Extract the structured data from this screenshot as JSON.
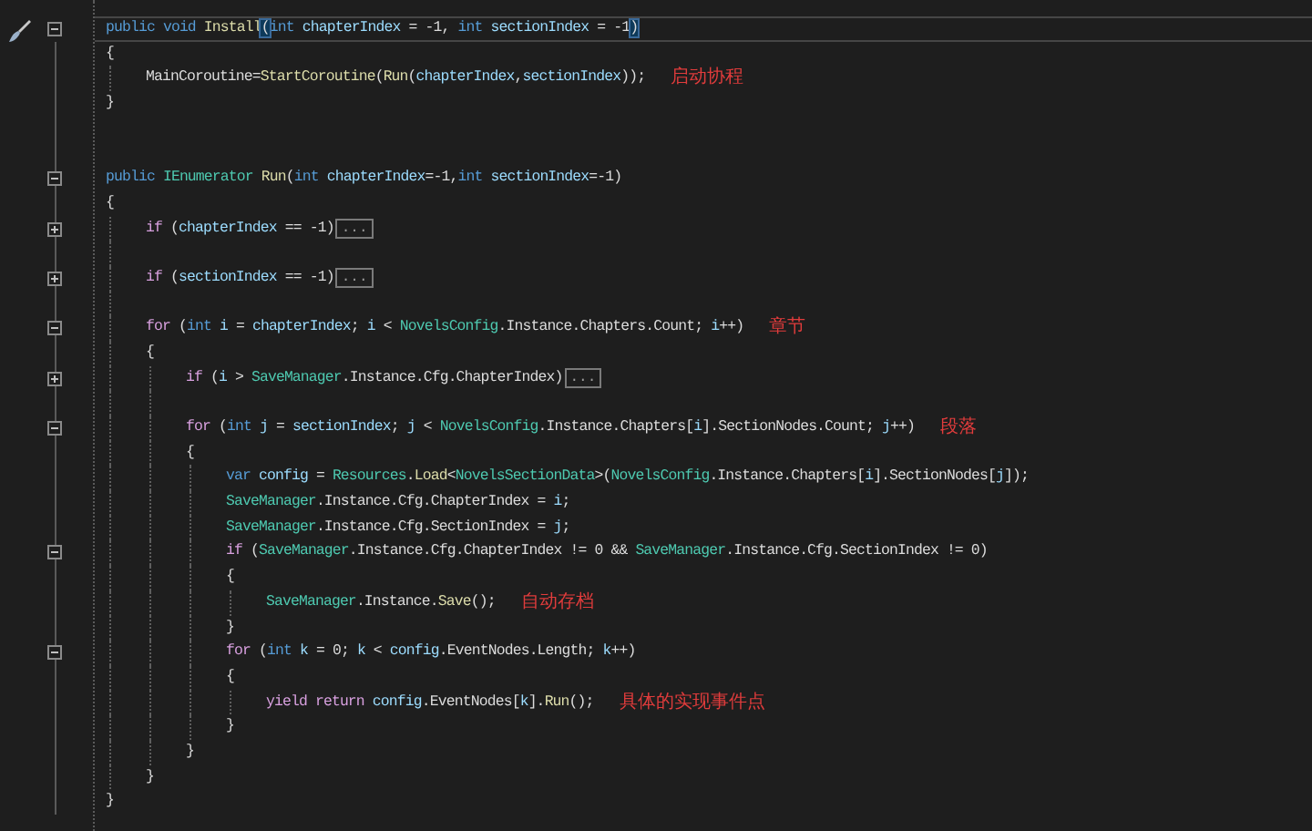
{
  "editor": {
    "lines": [
      {
        "kind": "code",
        "current": true,
        "folded": false,
        "tokens": [
          {
            "kind": "kw",
            "text": "public void "
          },
          {
            "kind": "fn",
            "text": "Install"
          },
          {
            "kind": "match",
            "text": "("
          },
          {
            "kind": "kw",
            "text": "int "
          },
          {
            "kind": "var",
            "text": "chapterIndex"
          },
          {
            "kind": "txt",
            "text": " = -1, "
          },
          {
            "kind": "kw",
            "text": "int "
          },
          {
            "kind": "var",
            "text": "sectionIndex"
          },
          {
            "kind": "txt",
            "text": " = -1"
          },
          {
            "kind": "match",
            "text": ")"
          }
        ]
      },
      {
        "kind": "code",
        "current": false,
        "tokens": [
          {
            "kind": "txt",
            "text": "{"
          }
        ],
        "children": [
          {
            "kind": "code",
            "current": false,
            "note": "启动协程",
            "tokens": [
              {
                "kind": "txt",
                "text": "MainCoroutine="
              },
              {
                "kind": "fn",
                "text": "StartCoroutine"
              },
              {
                "kind": "txt",
                "text": "("
              },
              {
                "kind": "fn",
                "text": "Run"
              },
              {
                "kind": "txt",
                "text": "("
              },
              {
                "kind": "var",
                "text": "chapterIndex"
              },
              {
                "kind": "txt",
                "text": ","
              },
              {
                "kind": "var",
                "text": "sectionIndex"
              },
              {
                "kind": "txt",
                "text": "));"
              }
            ]
          }
        ]
      },
      {
        "kind": "code",
        "current": false,
        "tokens": [
          {
            "kind": "txt",
            "text": "}"
          }
        ]
      },
      {
        "kind": "blank",
        "current": false
      },
      {
        "kind": "blank",
        "current": false
      },
      {
        "kind": "code",
        "current": false,
        "folded": false,
        "tokens": [
          {
            "kind": "kw",
            "text": "public "
          },
          {
            "kind": "type",
            "text": "IEnumerator "
          },
          {
            "kind": "fn",
            "text": "Run"
          },
          {
            "kind": "txt",
            "text": "("
          },
          {
            "kind": "kw",
            "text": "int "
          },
          {
            "kind": "var",
            "text": "chapterIndex"
          },
          {
            "kind": "txt",
            "text": "=-1,"
          },
          {
            "kind": "kw",
            "text": "int "
          },
          {
            "kind": "var",
            "text": "sectionIndex"
          },
          {
            "kind": "txt",
            "text": "=-1)"
          }
        ]
      },
      {
        "kind": "code",
        "current": false,
        "tokens": [
          {
            "kind": "txt",
            "text": "{"
          }
        ],
        "children": [
          {
            "kind": "code",
            "current": false,
            "folded": true,
            "collapsed_label": "...",
            "tokens": [
              {
                "kind": "ctl",
                "text": "if "
              },
              {
                "kind": "txt",
                "text": "("
              },
              {
                "kind": "var",
                "text": "chapterIndex"
              },
              {
                "kind": "txt",
                "text": " == -1)"
              }
            ]
          },
          {
            "kind": "blank",
            "current": false
          },
          {
            "kind": "code",
            "current": false,
            "folded": true,
            "collapsed_label": "...",
            "tokens": [
              {
                "kind": "ctl",
                "text": "if "
              },
              {
                "kind": "txt",
                "text": "("
              },
              {
                "kind": "var",
                "text": "sectionIndex"
              },
              {
                "kind": "txt",
                "text": " == -1)"
              }
            ]
          },
          {
            "kind": "blank",
            "current": false
          },
          {
            "kind": "code",
            "current": false,
            "folded": false,
            "note": "章节",
            "tokens": [
              {
                "kind": "ctl",
                "text": "for "
              },
              {
                "kind": "txt",
                "text": "("
              },
              {
                "kind": "kw",
                "text": "int "
              },
              {
                "kind": "var",
                "text": "i"
              },
              {
                "kind": "txt",
                "text": " = "
              },
              {
                "kind": "var",
                "text": "chapterIndex"
              },
              {
                "kind": "txt",
                "text": "; "
              },
              {
                "kind": "var",
                "text": "i"
              },
              {
                "kind": "txt",
                "text": " < "
              },
              {
                "kind": "type",
                "text": "NovelsConfig"
              },
              {
                "kind": "txt",
                "text": ".Instance.Chapters.Count; "
              },
              {
                "kind": "var",
                "text": "i"
              },
              {
                "kind": "txt",
                "text": "++)"
              }
            ]
          },
          {
            "kind": "code",
            "current": false,
            "tokens": [
              {
                "kind": "txt",
                "text": "{"
              }
            ],
            "children": [
              {
                "kind": "code",
                "current": false,
                "folded": true,
                "collapsed_label": "...",
                "tokens": [
                  {
                    "kind": "ctl",
                    "text": "if "
                  },
                  {
                    "kind": "txt",
                    "text": "("
                  },
                  {
                    "kind": "var",
                    "text": "i"
                  },
                  {
                    "kind": "txt",
                    "text": " > "
                  },
                  {
                    "kind": "type",
                    "text": "SaveManager"
                  },
                  {
                    "kind": "txt",
                    "text": ".Instance.Cfg.ChapterIndex)"
                  }
                ]
              },
              {
                "kind": "blank",
                "current": false
              },
              {
                "kind": "code",
                "current": false,
                "folded": false,
                "note": "段落",
                "tokens": [
                  {
                    "kind": "ctl",
                    "text": "for "
                  },
                  {
                    "kind": "txt",
                    "text": "("
                  },
                  {
                    "kind": "kw",
                    "text": "int "
                  },
                  {
                    "kind": "var",
                    "text": "j"
                  },
                  {
                    "kind": "txt",
                    "text": " = "
                  },
                  {
                    "kind": "var",
                    "text": "sectionIndex"
                  },
                  {
                    "kind": "txt",
                    "text": "; "
                  },
                  {
                    "kind": "var",
                    "text": "j"
                  },
                  {
                    "kind": "txt",
                    "text": " < "
                  },
                  {
                    "kind": "type",
                    "text": "NovelsConfig"
                  },
                  {
                    "kind": "txt",
                    "text": ".Instance.Chapters["
                  },
                  {
                    "kind": "var",
                    "text": "i"
                  },
                  {
                    "kind": "txt",
                    "text": "].SectionNodes.Count; "
                  },
                  {
                    "kind": "var",
                    "text": "j"
                  },
                  {
                    "kind": "txt",
                    "text": "++)"
                  }
                ]
              },
              {
                "kind": "code",
                "current": false,
                "tokens": [
                  {
                    "kind": "txt",
                    "text": "{"
                  }
                ],
                "children": [
                  {
                    "kind": "code",
                    "current": false,
                    "tokens": [
                      {
                        "kind": "kw",
                        "text": "var "
                      },
                      {
                        "kind": "var",
                        "text": "config"
                      },
                      {
                        "kind": "txt",
                        "text": " = "
                      },
                      {
                        "kind": "type",
                        "text": "Resources"
                      },
                      {
                        "kind": "txt",
                        "text": "."
                      },
                      {
                        "kind": "fn",
                        "text": "Load"
                      },
                      {
                        "kind": "txt",
                        "text": "<"
                      },
                      {
                        "kind": "type",
                        "text": "NovelsSectionData"
                      },
                      {
                        "kind": "txt",
                        "text": ">("
                      },
                      {
                        "kind": "type",
                        "text": "NovelsConfig"
                      },
                      {
                        "kind": "txt",
                        "text": ".Instance.Chapters["
                      },
                      {
                        "kind": "var",
                        "text": "i"
                      },
                      {
                        "kind": "txt",
                        "text": "].SectionNodes["
                      },
                      {
                        "kind": "var",
                        "text": "j"
                      },
                      {
                        "kind": "txt",
                        "text": "]);"
                      }
                    ]
                  },
                  {
                    "kind": "code",
                    "current": false,
                    "tokens": [
                      {
                        "kind": "type",
                        "text": "SaveManager"
                      },
                      {
                        "kind": "txt",
                        "text": ".Instance.Cfg.ChapterIndex = "
                      },
                      {
                        "kind": "var",
                        "text": "i"
                      },
                      {
                        "kind": "txt",
                        "text": ";"
                      }
                    ]
                  },
                  {
                    "kind": "code",
                    "current": false,
                    "tokens": [
                      {
                        "kind": "type",
                        "text": "SaveManager"
                      },
                      {
                        "kind": "txt",
                        "text": ".Instance.Cfg.SectionIndex = "
                      },
                      {
                        "kind": "var",
                        "text": "j"
                      },
                      {
                        "kind": "txt",
                        "text": ";"
                      }
                    ]
                  },
                  {
                    "kind": "code",
                    "current": false,
                    "folded": false,
                    "tokens": [
                      {
                        "kind": "ctl",
                        "text": "if "
                      },
                      {
                        "kind": "txt",
                        "text": "("
                      },
                      {
                        "kind": "type",
                        "text": "SaveManager"
                      },
                      {
                        "kind": "txt",
                        "text": ".Instance.Cfg.ChapterIndex != 0 && "
                      },
                      {
                        "kind": "type",
                        "text": "SaveManager"
                      },
                      {
                        "kind": "txt",
                        "text": ".Instance.Cfg.SectionIndex != 0)"
                      }
                    ]
                  },
                  {
                    "kind": "code",
                    "current": false,
                    "tokens": [
                      {
                        "kind": "txt",
                        "text": "{"
                      }
                    ],
                    "children": [
                      {
                        "kind": "code",
                        "current": false,
                        "note": "自动存档",
                        "tokens": [
                          {
                            "kind": "type",
                            "text": "SaveManager"
                          },
                          {
                            "kind": "txt",
                            "text": ".Instance."
                          },
                          {
                            "kind": "fn",
                            "text": "Save"
                          },
                          {
                            "kind": "txt",
                            "text": "();"
                          }
                        ]
                      }
                    ]
                  },
                  {
                    "kind": "code",
                    "current": false,
                    "tokens": [
                      {
                        "kind": "txt",
                        "text": "}"
                      }
                    ]
                  },
                  {
                    "kind": "code",
                    "current": false,
                    "folded": false,
                    "tokens": [
                      {
                        "kind": "ctl",
                        "text": "for "
                      },
                      {
                        "kind": "txt",
                        "text": "("
                      },
                      {
                        "kind": "kw",
                        "text": "int "
                      },
                      {
                        "kind": "var",
                        "text": "k"
                      },
                      {
                        "kind": "txt",
                        "text": " = 0; "
                      },
                      {
                        "kind": "var",
                        "text": "k"
                      },
                      {
                        "kind": "txt",
                        "text": " < "
                      },
                      {
                        "kind": "var",
                        "text": "config"
                      },
                      {
                        "kind": "txt",
                        "text": ".EventNodes.Length; "
                      },
                      {
                        "kind": "var",
                        "text": "k"
                      },
                      {
                        "kind": "txt",
                        "text": "++)"
                      }
                    ]
                  },
                  {
                    "kind": "code",
                    "current": false,
                    "tokens": [
                      {
                        "kind": "txt",
                        "text": "{"
                      }
                    ],
                    "children": [
                      {
                        "kind": "code",
                        "current": false,
                        "note": "具体的实现事件点",
                        "tokens": [
                          {
                            "kind": "ctl",
                            "text": "yield return "
                          },
                          {
                            "kind": "var",
                            "text": "config"
                          },
                          {
                            "kind": "txt",
                            "text": ".EventNodes["
                          },
                          {
                            "kind": "var",
                            "text": "k"
                          },
                          {
                            "kind": "txt",
                            "text": "]."
                          },
                          {
                            "kind": "fn",
                            "text": "Run"
                          },
                          {
                            "kind": "txt",
                            "text": "();"
                          }
                        ]
                      }
                    ]
                  },
                  {
                    "kind": "code",
                    "current": false,
                    "tokens": [
                      {
                        "kind": "txt",
                        "text": "}"
                      }
                    ]
                  }
                ]
              },
              {
                "kind": "code",
                "current": false,
                "tokens": [
                  {
                    "kind": "txt",
                    "text": "}"
                  }
                ]
              }
            ]
          },
          {
            "kind": "code",
            "current": false,
            "tokens": [
              {
                "kind": "txt",
                "text": "}"
              }
            ]
          }
        ]
      },
      {
        "kind": "code",
        "current": false,
        "tokens": [
          {
            "kind": "txt",
            "text": "}"
          }
        ]
      }
    ]
  }
}
